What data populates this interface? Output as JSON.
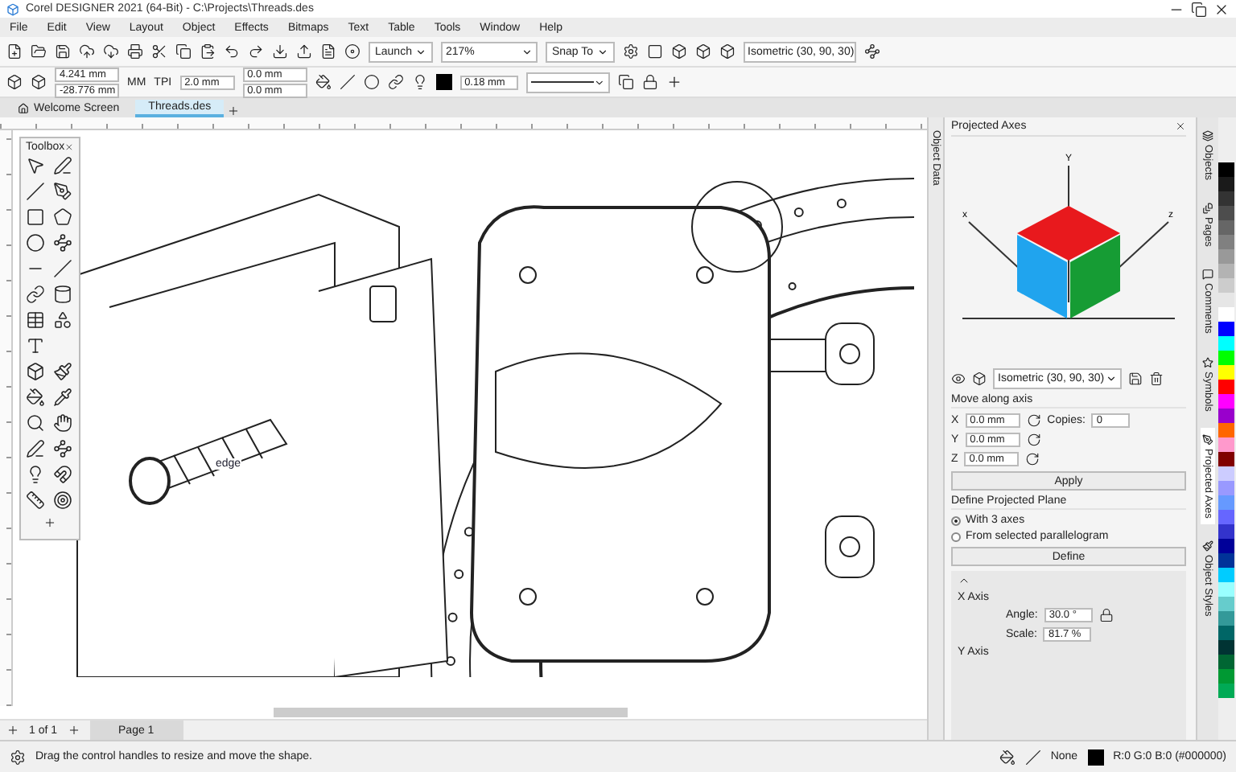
{
  "window": {
    "title": "Corel DESIGNER 2021 (64-Bit) - C:\\Projects\\Threads.des"
  },
  "menu": [
    "File",
    "Edit",
    "View",
    "Layout",
    "Object",
    "Effects",
    "Bitmaps",
    "Text",
    "Table",
    "Tools",
    "Window",
    "Help"
  ],
  "toolbar": {
    "launch": "Launch",
    "zoom": "217%",
    "snap": "Snap To",
    "projection": "Isometric (30, 90, 30)"
  },
  "property_bar": {
    "x": "4.241 mm",
    "y": "-28.776 mm",
    "units": "MM",
    "tpi_label": "TPI",
    "tpi": "2.0 mm",
    "offset_1": "0.0 mm",
    "offset_2": "0.0 mm",
    "outline_width": "0.18 mm"
  },
  "tabs": [
    {
      "label": "Welcome Screen",
      "selected": false
    },
    {
      "label": "Threads.des",
      "selected": true
    }
  ],
  "toolbox": {
    "title": "Toolbox"
  },
  "canvas": {
    "label": "edge"
  },
  "object_data_tab": "Object Data",
  "docker": {
    "title": "Projected Axes",
    "cube_axes": [
      "x",
      "Y",
      "z"
    ],
    "preset": "Isometric (30, 90, 30)",
    "move_heading": "Move along axis",
    "axes": [
      {
        "label": "X",
        "value": "0.0 mm"
      },
      {
        "label": "Y",
        "value": "0.0 mm"
      },
      {
        "label": "Z",
        "value": "0.0 mm"
      }
    ],
    "copies_label": "Copies:",
    "copies": "0",
    "apply": "Apply",
    "plane_heading": "Define Projected Plane",
    "plane_options": [
      {
        "label": "With 3 axes",
        "selected": true
      },
      {
        "label": "From selected parallelogram",
        "selected": false
      }
    ],
    "define": "Define",
    "x_axis": {
      "heading": "X Axis",
      "angle_label": "Angle:",
      "angle": "30.0 °",
      "scale_label": "Scale:",
      "scale": "81.7 %"
    },
    "y_axis_heading": "Y Axis"
  },
  "side_tabs": [
    {
      "label": "Objects",
      "selected": false
    },
    {
      "label": "Pages",
      "selected": false
    },
    {
      "label": "Comments",
      "selected": false
    },
    {
      "label": "Symbols",
      "selected": false
    },
    {
      "label": "Projected Axes",
      "selected": true
    },
    {
      "label": "Object Styles",
      "selected": false
    }
  ],
  "palette": [
    {
      "color": "#000000"
    },
    {
      "color": "#1a1a1a"
    },
    {
      "color": "#333333"
    },
    {
      "color": "#4d4d4d"
    },
    {
      "color": "#666666"
    },
    {
      "color": "#808080"
    },
    {
      "color": "#999999"
    },
    {
      "color": "#b3b3b3"
    },
    {
      "color": "#cccccc"
    },
    {
      "color": "#e6e6e6"
    },
    {
      "color": "#ffffff"
    },
    {
      "color": "#0000ff"
    },
    {
      "color": "#00ffff"
    },
    {
      "color": "#00ff00"
    },
    {
      "color": "#ffff00"
    },
    {
      "color": "#ff0000"
    },
    {
      "color": "#ff00ff"
    },
    {
      "color": "#9900cc"
    },
    {
      "color": "#ff6600"
    },
    {
      "color": "#ff99cc"
    },
    {
      "color": "#800000"
    },
    {
      "color": "#ccccff"
    },
    {
      "color": "#9999ff"
    },
    {
      "color": "#6699ff"
    },
    {
      "color": "#6666ff"
    },
    {
      "color": "#3333cc"
    },
    {
      "color": "#000099"
    },
    {
      "color": "#003399"
    },
    {
      "color": "#00ccff"
    },
    {
      "color": "#99ffff"
    },
    {
      "color": "#66cccc"
    },
    {
      "color": "#339999"
    },
    {
      "color": "#006666"
    },
    {
      "color": "#003333"
    },
    {
      "color": "#006633"
    },
    {
      "color": "#009933"
    },
    {
      "color": "#00aa55"
    }
  ],
  "page_nav": {
    "counter": "1 of 1",
    "page_tab": "Page 1"
  },
  "status_bar": {
    "hint": "Drag the control handles to resize and move the shape.",
    "fill": "None",
    "color_readout": "R:0 G:0 B:0 (#000000)"
  }
}
